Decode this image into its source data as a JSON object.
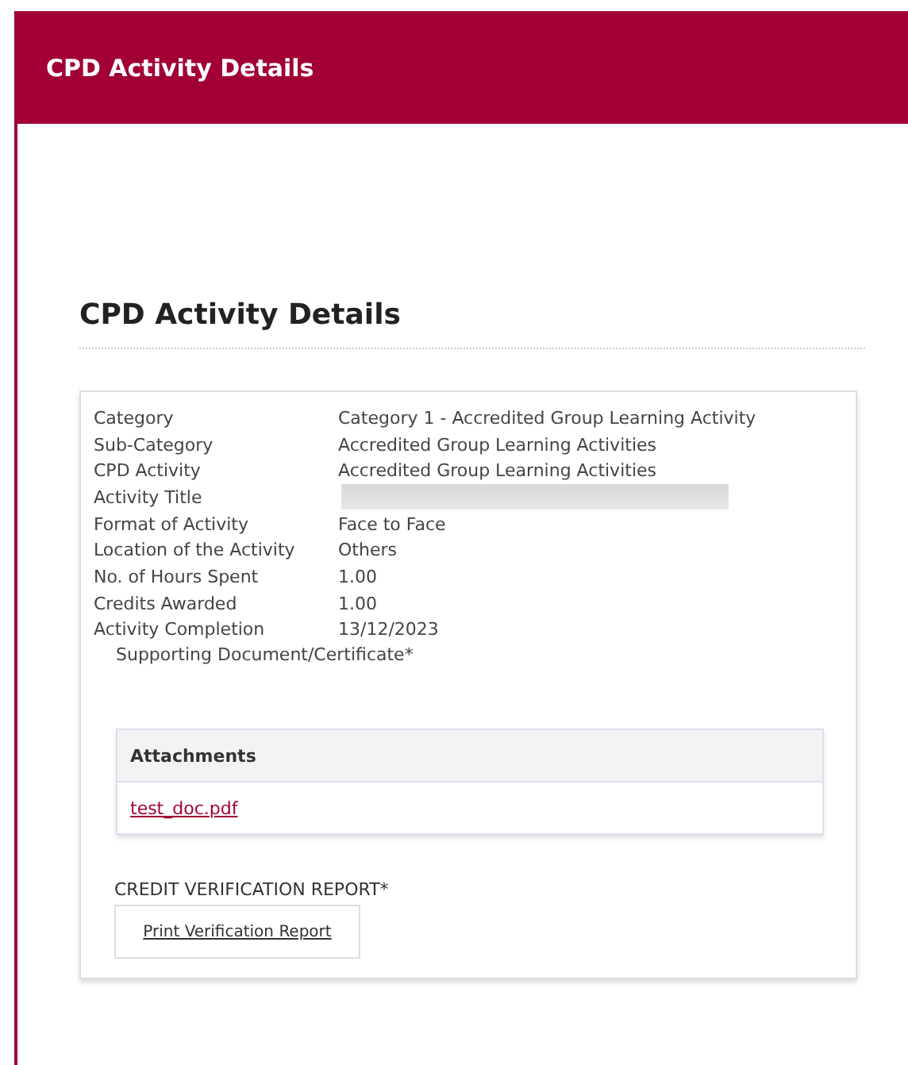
{
  "header": {
    "title": "CPD Activity Details"
  },
  "section": {
    "heading": "CPD Activity Details"
  },
  "details": [
    {
      "label": "Category",
      "kind": "text",
      "value": "Category 1 - Accredited Group Learning Activity"
    },
    {
      "label": "Sub-Category",
      "kind": "text",
      "value": "Accredited Group Learning Activities"
    },
    {
      "label": "CPD Activity",
      "kind": "text",
      "value": "Accredited Group Learning Activities"
    },
    {
      "label": "Activity Title",
      "kind": "redacted"
    },
    {
      "label": "Format of Activity",
      "kind": "text",
      "value": "Face to Face"
    },
    {
      "label": "Location of the Activity",
      "kind": "text",
      "value": "Others"
    },
    {
      "label": "No. of Hours Spent",
      "kind": "text",
      "value": "1.00"
    },
    {
      "label": "Credits Awarded",
      "kind": "text",
      "value": "1.00"
    },
    {
      "label": "Activity Completion",
      "kind": "text",
      "value": "13/12/2023"
    }
  ],
  "supporting_label": "Supporting Document/Certificate*",
  "attachments": {
    "heading": "Attachments",
    "files": [
      "test_doc.pdf"
    ]
  },
  "verification": {
    "label": "CREDIT VERIFICATION REPORT*",
    "button": "Print Verification Report"
  }
}
